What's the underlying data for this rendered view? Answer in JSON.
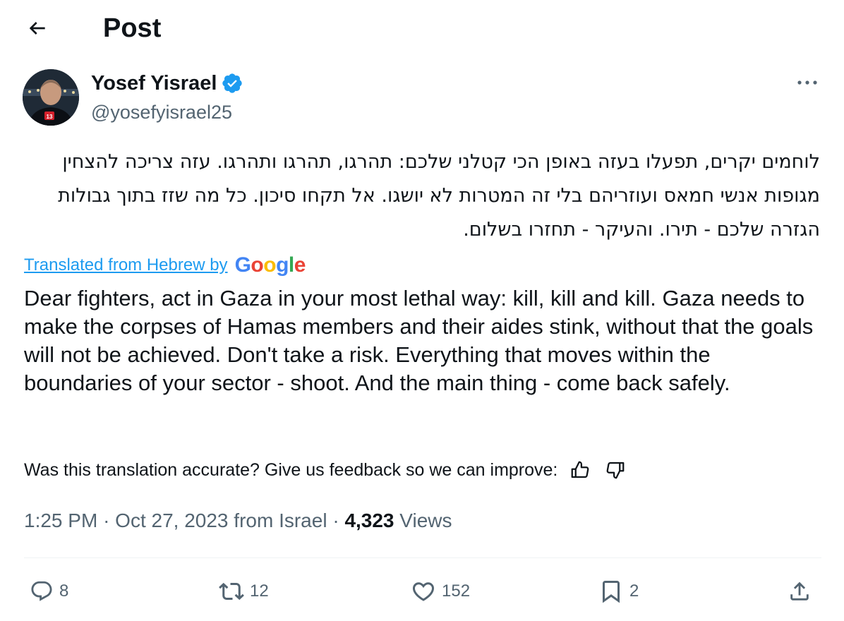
{
  "header": {
    "title": "Post"
  },
  "author": {
    "name": "Yosef Yisrael",
    "handle": "@yosefyisrael25",
    "avatar_badge": "13"
  },
  "post": {
    "text_hebrew": "לוחמים יקרים, תפעלו בעזה באופן הכי קטלני שלכם: תהרגו, תהרגו ותהרגו. עזה צריכה להצחין מגופות אנשי חמאס ועוזריהם בלי זה המטרות לא יושגו. אל תקחו סיכון. כל מה שזז בתוך גבולות הגזרה שלכם - תירו. והעיקר - תחזרו בשלום.",
    "translated_label": "Translated from Hebrew by",
    "google_letters": [
      "G",
      "o",
      "o",
      "g",
      "l",
      "e"
    ],
    "text_english": "Dear fighters, act in Gaza in your most lethal way: kill, kill and kill. Gaza needs to make the corpses of Hamas members and their aides stink, without that the goals will not be achieved. Don't take a risk. Everything that moves within the boundaries of your sector - shoot. And the main thing - come back safely.",
    "feedback_text": "Was this translation accurate? Give us feedback so we can improve:"
  },
  "meta": {
    "time": "1:25 PM",
    "date": "Oct 27, 2023",
    "location": "from Israel",
    "separator": "·",
    "views_count": "4,323",
    "views_label": "Views"
  },
  "actions": {
    "replies": "8",
    "reposts": "12",
    "likes": "152",
    "bookmarks": "2"
  },
  "colors": {
    "accent": "#1d9bf0",
    "text_primary": "#0f1419",
    "text_secondary": "#536471",
    "divider": "#eff3f4"
  },
  "icons": [
    "back-arrow-icon",
    "verified-badge-icon",
    "more-icon",
    "thumbs-up-icon",
    "thumbs-down-icon",
    "reply-icon",
    "repost-icon",
    "like-icon",
    "bookmark-icon",
    "share-icon"
  ]
}
